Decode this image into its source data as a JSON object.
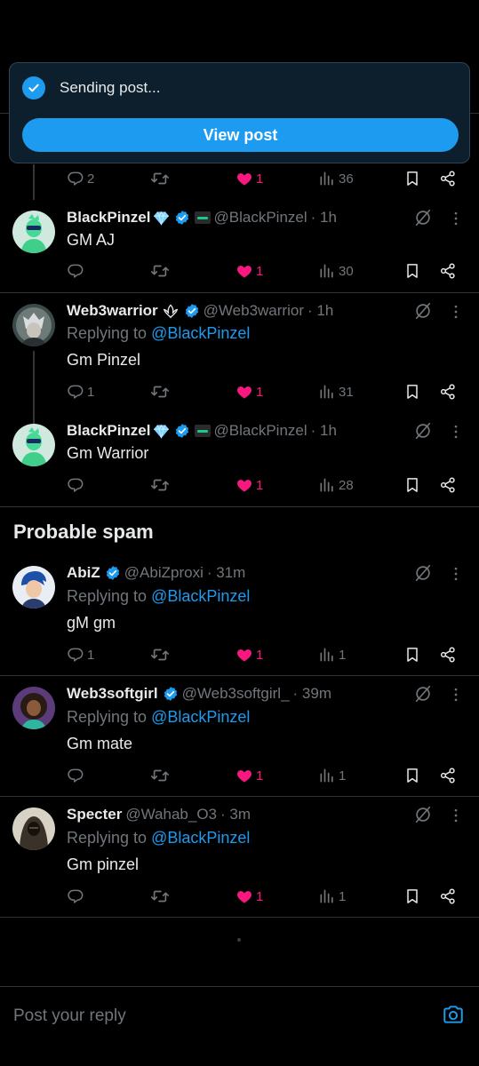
{
  "toast": {
    "status": "Sending post...",
    "button_label": "View post"
  },
  "posts": [
    {
      "name": "BlackPinzel",
      "handle": "@BlackPinzel",
      "time": "· 1h",
      "replying_to": "",
      "text": "GM AJ",
      "replies": "",
      "likes": "1",
      "views": "30"
    },
    {
      "name": "Web3warrior",
      "handle": "@Web3warrior",
      "time": "· 1h",
      "replying_prefix": "Replying to ",
      "replying_to": "@BlackPinzel",
      "text": "Gm Pinzel",
      "replies": "1",
      "likes": "1",
      "views": "31"
    },
    {
      "name": "BlackPinzel",
      "handle": "@BlackPinzel",
      "time": "· 1h",
      "replying_to": "",
      "text": "Gm Warrior",
      "replies": "",
      "likes": "1",
      "views": "28"
    }
  ],
  "top_actions": {
    "replies": "2",
    "likes": "1",
    "views": "36"
  },
  "spam_section": {
    "title": "Probable spam",
    "posts": [
      {
        "name": "AbiZ",
        "handle": "@AbiZproxi",
        "time": "· 31m",
        "replying_prefix": "Replying to ",
        "replying_to": "@BlackPinzel",
        "text": "gM gm",
        "replies": "1",
        "likes": "1",
        "views": "1"
      },
      {
        "name": "Web3softgirl",
        "handle": "@Web3softgirl_",
        "time": "· 39m",
        "replying_prefix": "Replying to ",
        "replying_to": "@BlackPinzel",
        "text": "Gm mate",
        "replies": "",
        "likes": "1",
        "views": "1"
      },
      {
        "name": "Specter",
        "handle": "@Wahab_O3",
        "time": "· 3m",
        "replying_prefix": "Replying to ",
        "replying_to": "@BlackPinzel",
        "text": "Gm pinzel",
        "replies": "",
        "likes": "1",
        "views": "1"
      }
    ]
  },
  "composer": {
    "placeholder": "Post your reply"
  },
  "colors": {
    "accent": "#1d9bf0",
    "like": "#f91880",
    "muted": "#71767b",
    "background": "#000000"
  }
}
